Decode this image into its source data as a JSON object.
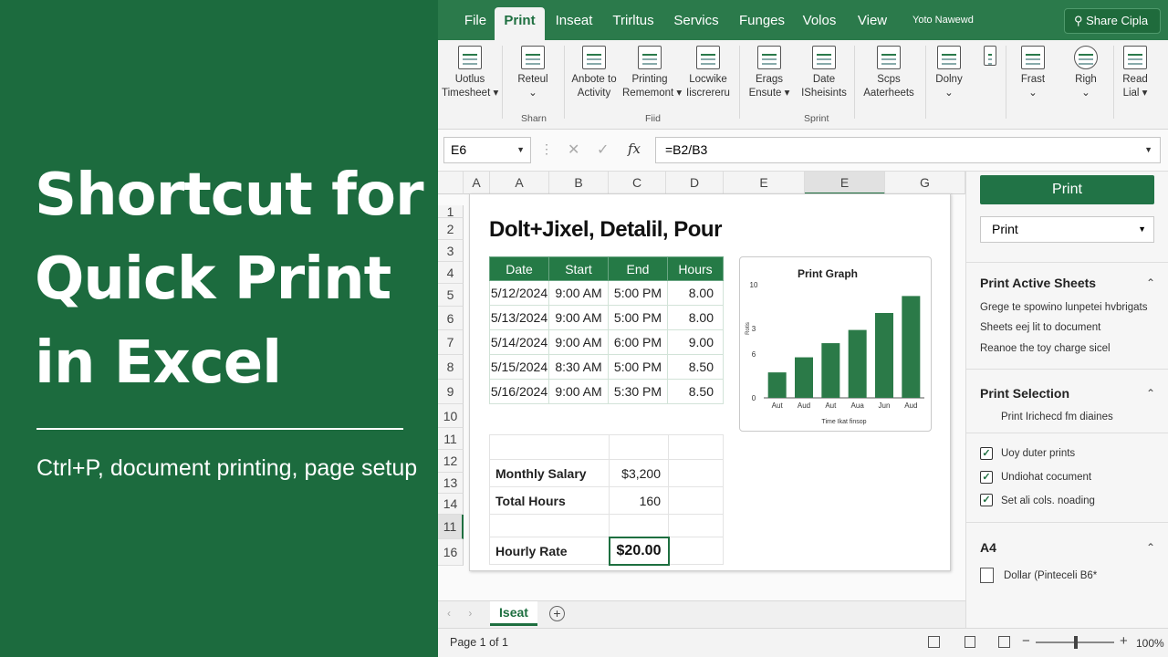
{
  "banner": {
    "line1": "Shortcut for",
    "line2": "Quick Print",
    "line3": "in Excel",
    "subtitle": "Ctrl+P, document printing, page setup"
  },
  "tabs": [
    "File",
    "Print",
    "Inseat",
    "Trirltus",
    "Servics",
    "Funges",
    "Volos",
    "View"
  ],
  "active_tab": "Print",
  "user_name": "Yoto Nawewd",
  "share_label": "Share Cipla",
  "ribbon": {
    "buttons": [
      {
        "line1": "Uotlus",
        "line2": "Timesheet ▾"
      },
      {
        "line1": "Reteul",
        "line2": "⌄"
      },
      {
        "line1": "Anbote to",
        "line2": "Activity"
      },
      {
        "line1": "Printing",
        "line2": "Rememont ▾"
      },
      {
        "line1": "Locwike",
        "line2": "Iiscrereru"
      },
      {
        "line1": "Erags",
        "line2": "Ensute ▾"
      },
      {
        "line1": "Date",
        "line2": "ISheisints"
      },
      {
        "line1": "Scps",
        "line2": "Aaterheets"
      },
      {
        "line1": "Dolny",
        "line2": "⌄"
      },
      {
        "line1": "",
        "line2": ""
      },
      {
        "line1": "Frast",
        "line2": "⌄"
      },
      {
        "line1": "Righ",
        "line2": "⌄"
      },
      {
        "line1": "Read",
        "line2": "Lial ▾"
      }
    ],
    "groups": [
      "Sharn",
      "Fiid",
      "Sprint"
    ]
  },
  "formula": {
    "cell_ref": "E6",
    "value": "=B2/B3"
  },
  "columns": [
    "A",
    "A",
    "B",
    "C",
    "D",
    "E",
    "E",
    "G"
  ],
  "selected_column": "E",
  "rows": [
    "1",
    "2",
    "3",
    "4",
    "5",
    "6",
    "7",
    "8",
    "9",
    "10",
    "11",
    "12",
    "13",
    "14",
    "11",
    "16"
  ],
  "sheet": {
    "title": "Dolt+Jixel, Detalil, Pour",
    "headers": [
      "Date",
      "Start",
      "End",
      "Hours"
    ],
    "entries": [
      [
        "5/12/2024",
        "9:00 AM",
        "5:00 PM",
        "8.00"
      ],
      [
        "5/13/2024",
        "9:00 AM",
        "5:00 PM",
        "8.00"
      ],
      [
        "5/14/2024",
        "9:00 AM",
        "6:00 PM",
        "9.00"
      ],
      [
        "5/15/2024",
        "8:30 AM",
        "5:00 PM",
        "8.50"
      ],
      [
        "5/16/2024",
        "9:00 AM",
        "5:30 PM",
        "8.50"
      ]
    ],
    "monthly_salary_label": "Monthly Salary",
    "monthly_salary": "$3,200",
    "total_hours_label": "Total Hours",
    "total_hours": "160",
    "hourly_rate_label": "Hourly Rate",
    "hourly_rate": "$20.00"
  },
  "chart_data": {
    "type": "bar",
    "title": "Print Graph",
    "xlabel": "Time Ikat finsop",
    "ylabel": "Rotis",
    "categories": [
      "Aut",
      "Aud",
      "Aut",
      "Aua",
      "Jun",
      "Aud"
    ],
    "values": [
      2.7,
      4.3,
      5.8,
      7.2,
      9.0,
      10.8
    ],
    "yticks": [
      "10",
      "3",
      "6",
      "0"
    ],
    "ylim": [
      0,
      12
    ],
    "grid": false,
    "legend": "none",
    "color": "#2b7a48"
  },
  "sheet_tabs": {
    "active": "Iseat",
    "nav": "‹ ›"
  },
  "panel": {
    "print_button": "Print",
    "print_select": "Print",
    "active_sheets_title": "Print Active Sheets",
    "active_sheets_lines": [
      "Grege te spowino lunpetei hvbrigats",
      "Sheets eej lit to document",
      "Reanoe the toy charge sicel"
    ],
    "selection_title": "Print Selection",
    "selection_line": "Print Irichecd fm diaines",
    "checkboxes": [
      "Uoy duter prints",
      "Undiohat cocument",
      "Set ali cols. noading"
    ],
    "paper_title": "A4",
    "paper_line": "Dollar (Pinteceli B6*"
  },
  "status": {
    "page": "Page 1 of 1",
    "zoom": "100%"
  }
}
